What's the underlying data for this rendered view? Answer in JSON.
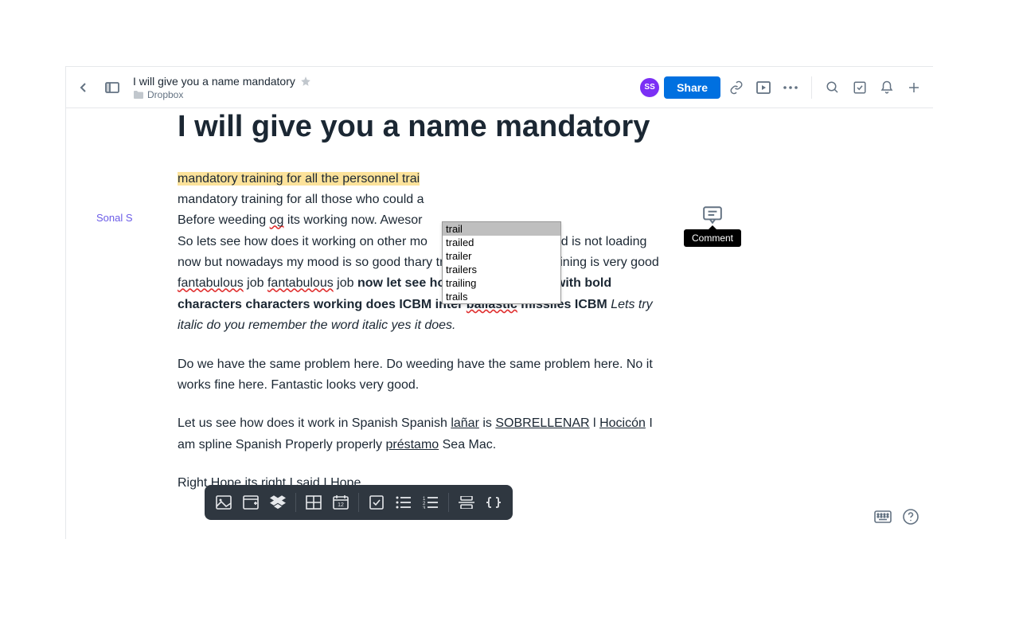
{
  "header": {
    "doc_title": "I will give you a name mandatory",
    "location": "Dropbox",
    "avatar_initials": "SS",
    "share_label": "Share"
  },
  "document": {
    "heading": "I will give you a name mandatory",
    "author": "Sonal S",
    "highlighted_line": "mandatory training for all the personnel trai",
    "p1_a": "mandatory training for all those who could a",
    "p1_b": "Before weeding ",
    "p1_og": "og",
    "p1_c": " its working now. Awesor",
    "p1_d": "So lets see how does it working on other mo",
    "p1_e": "ded is not loading now but nowadays my mood is so good tha",
    "p1_f": "ry training mandatory training is very good ",
    "p1_fant1": "fantabulous",
    "p1_g": " job ",
    "p1_fant2": "fantabulous",
    "p1_h": " job ",
    "p1_bold": "now let see how does it working with bold characters characters working does ICBM inter ",
    "p1_ballastic": "ballastic",
    "p1_bold2": " missiles ICBM ",
    "p1_italic": "Lets try italic do you remember the word italic yes it does.",
    "p2": "Do we have the same problem here. Do weeding have the same problem here. No it works fine here. Fantastic looks very good.",
    "p3_a": "Let us see how does it work in Spanish Spanish ",
    "p3_lanar": "lañar",
    "p3_b": " is ",
    "p3_sobre": "SOBRELLENAR",
    "p3_c": " l ",
    "p3_hoc": "Hocicón",
    "p3_d": " I am spline Spanish Properly properly ",
    "p3_prest": "préstamo",
    "p3_e": " Sea Mac.",
    "p4": "Right Hope its right I said I Hope."
  },
  "autocomplete": {
    "items": [
      "trail",
      "trailed",
      "trailer",
      "trailers",
      "trailing",
      "trails"
    ]
  },
  "comment": {
    "tooltip": "Comment"
  }
}
